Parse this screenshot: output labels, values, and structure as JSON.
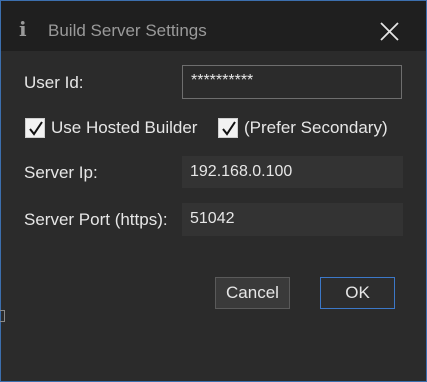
{
  "window": {
    "title": "Build Server Settings",
    "icon": "info-icon",
    "icon_glyph": "i",
    "close_icon": "close-icon"
  },
  "form": {
    "user_id": {
      "label": "User Id:",
      "value": "**********"
    },
    "hosted_builder": {
      "label": "Use Hosted Builder",
      "checked": true
    },
    "prefer_secondary": {
      "label": "(Prefer Secondary)",
      "checked": true
    },
    "server_ip": {
      "label": "Server Ip:",
      "value": "192.168.0.100"
    },
    "server_port": {
      "label": "Server Port (https):",
      "value": "51042"
    }
  },
  "buttons": {
    "cancel_label": "Cancel",
    "ok_label": "OK"
  },
  "colors": {
    "accent": "#3c78c8",
    "background": "#2b2b2b",
    "titlebar": "#1f1f1f",
    "text": "#e6e6e6"
  }
}
